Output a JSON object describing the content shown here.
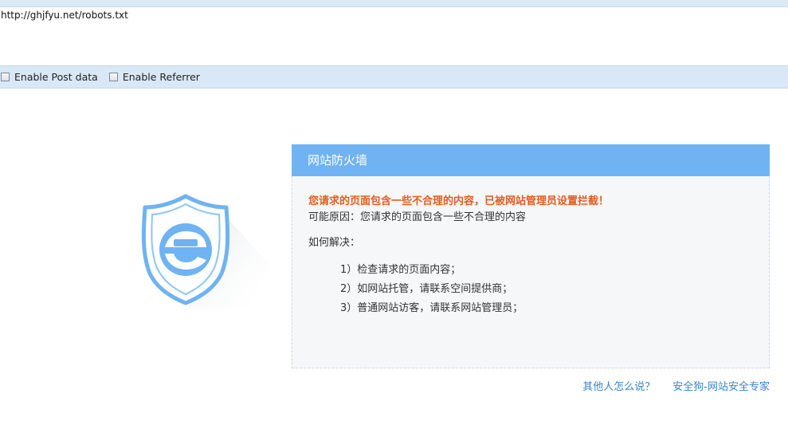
{
  "url_bar": {
    "url": "http://ghjfyu.net/robots.txt"
  },
  "options": {
    "post_data_label": "Enable Post data",
    "referrer_label": "Enable Referrer"
  },
  "panel": {
    "title": "网站防火墙",
    "warning": "您请求的页面包含一些不合理的内容，已被网站管理员设置拦截！",
    "reason": "可能原因：您请求的页面包含一些不合理的内容",
    "how_title": "如何解决：",
    "steps": [
      "1）检查请求的页面内容；",
      "2）如网站托管，请联系空间提供商；",
      "3）普通网站访客，请联系网站管理员；"
    ]
  },
  "footer": {
    "link_1": "其他人怎么说？",
    "link_2": "安全狗-网站安全专家"
  },
  "colors": {
    "accent": "#6fb3f2",
    "warning": "#e55b1f",
    "link": "#3a84c6"
  }
}
